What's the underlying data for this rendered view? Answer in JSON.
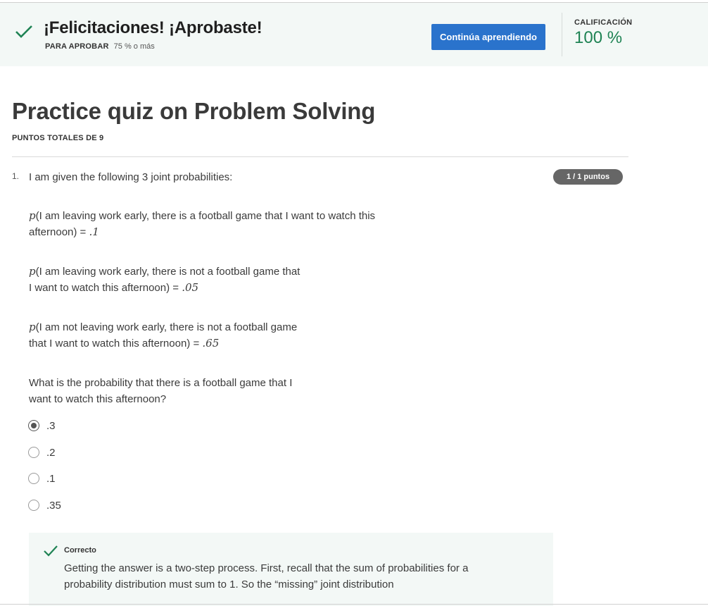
{
  "banner": {
    "title": "¡Felicitaciones! ¡Aprobaste!",
    "pass_label": "PARA APROBAR",
    "pass_value": "75 % o más",
    "continue_button": "Continúa aprendiendo",
    "grade_label": "CALIFICACIÓN",
    "grade_value": "100 %",
    "accent_color": "#1f8354",
    "button_color": "#2a73cc"
  },
  "quiz": {
    "title": "Practice quiz on Problem Solving",
    "total_points": "PUNTOS TOTALES DE 9"
  },
  "question": {
    "number": "1.",
    "points_badge": "1 / 1 puntos",
    "intro": "I am given the following 3 joint probabilities:",
    "probabilities": [
      {
        "symbol": "p",
        "line1": "(I am leaving work early, there is a football game that I want to watch this",
        "line2": "afternoon) = ",
        "value": ".1"
      },
      {
        "symbol": "p",
        "line1": "(I am leaving work early, there is not a football game that",
        "line2": "I want to watch this afternoon) = ",
        "value": ".05"
      },
      {
        "symbol": "p",
        "line1": "(I am not leaving work early, there is not a football game",
        "line2": "that I want to watch this afternoon) = ",
        "value": ".65"
      }
    ],
    "prompt_line1": "What is the probability that there is a football game that I",
    "prompt_line2": "want to watch this afternoon?",
    "options": [
      {
        "label": ".3",
        "selected": true
      },
      {
        "label": ".2",
        "selected": false
      },
      {
        "label": ".1",
        "selected": false
      },
      {
        "label": ".35",
        "selected": false
      }
    ]
  },
  "feedback": {
    "label": "Correcto",
    "text_line1": "Getting the answer is a two-step process. First, recall that the sum of probabilities for a",
    "text_line2": "probability distribution must sum to 1. So the “missing” joint distribution"
  }
}
